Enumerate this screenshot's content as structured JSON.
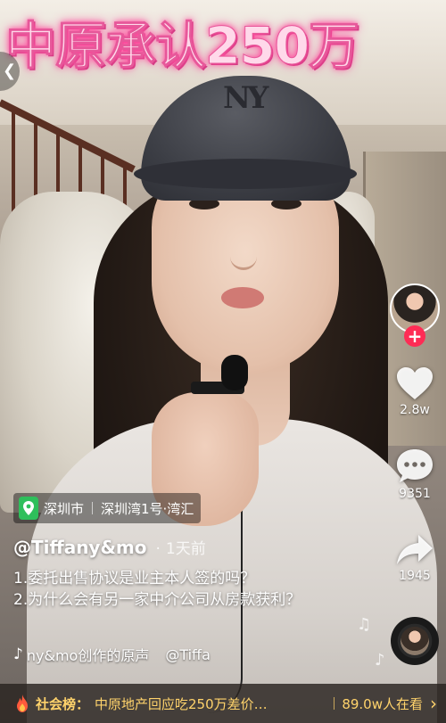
{
  "video": {
    "headline_overlay": "中原承认250万",
    "cap_logo": "NY"
  },
  "right_rail": {
    "follow_symbol": "+",
    "likes": "2.8w",
    "comments": "9351",
    "shares": "1945"
  },
  "location": {
    "city": "深圳市",
    "place": "深圳湾1号·湾汇"
  },
  "post": {
    "username": "@Tiffany&mo",
    "time": "1天前",
    "caption_line1": "1.委托出售协议是业主本人签的吗？",
    "caption_line2": "2.为什么会有另一家中介公司从房款获利？"
  },
  "sound": {
    "text": "ny&mo创作的原声",
    "text2": "@Tiffa"
  },
  "hot_topic": {
    "label": "社会榜：",
    "title": "中原地产回应吃250万差价…",
    "viewers": "89.0w人在看",
    "arrow": "›"
  },
  "colors": {
    "headline": "#ffd9ea",
    "headline_glow": "#ff4fa0",
    "follow_red": "#fe2c55",
    "hot_text": "#ffd36b",
    "pin_green": "#2fbf5b"
  },
  "icons": [
    "back-chevron-icon",
    "heart-icon",
    "comment-icon",
    "share-icon",
    "location-pin-icon",
    "music-note-icon",
    "fire-icon",
    "chevron-right-icon"
  ]
}
